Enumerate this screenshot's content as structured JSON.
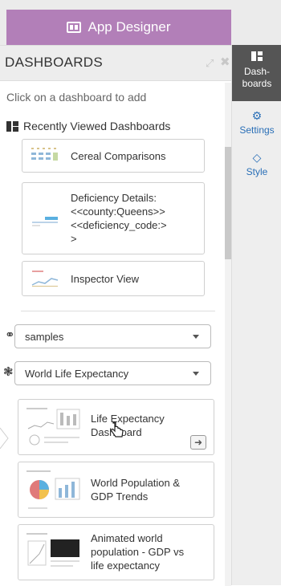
{
  "app_button": {
    "label": "App Designer"
  },
  "panel": {
    "title": "DASHBOARDS",
    "hint": "Click on a dashboard to add",
    "recent_heading": "Recently Viewed Dashboards"
  },
  "recent": [
    {
      "label": "Cereal Comparisons"
    },
    {
      "lines": [
        "Deficiency Details:",
        "<<county:Queens>>",
        "<<deficiency_code:>",
        ">"
      ]
    },
    {
      "label": "Inspector View"
    }
  ],
  "selects": {
    "connection": "samples",
    "dataset": "World Life Expectancy"
  },
  "library": [
    {
      "lines": [
        "Life Expectancy",
        "Dashboard"
      ]
    },
    {
      "lines": [
        "World Population &",
        "GDP Trends"
      ]
    },
    {
      "lines": [
        "Animated world",
        "population - GDP vs",
        "life expectancy"
      ]
    }
  ],
  "rail": {
    "dashboards": [
      "Dash-",
      "boards"
    ],
    "settings": "Settings",
    "style": "Style"
  },
  "colors": {
    "accent": "#b27fb8",
    "rail_active": "#555555",
    "rail_link": "#2a6fb7"
  }
}
